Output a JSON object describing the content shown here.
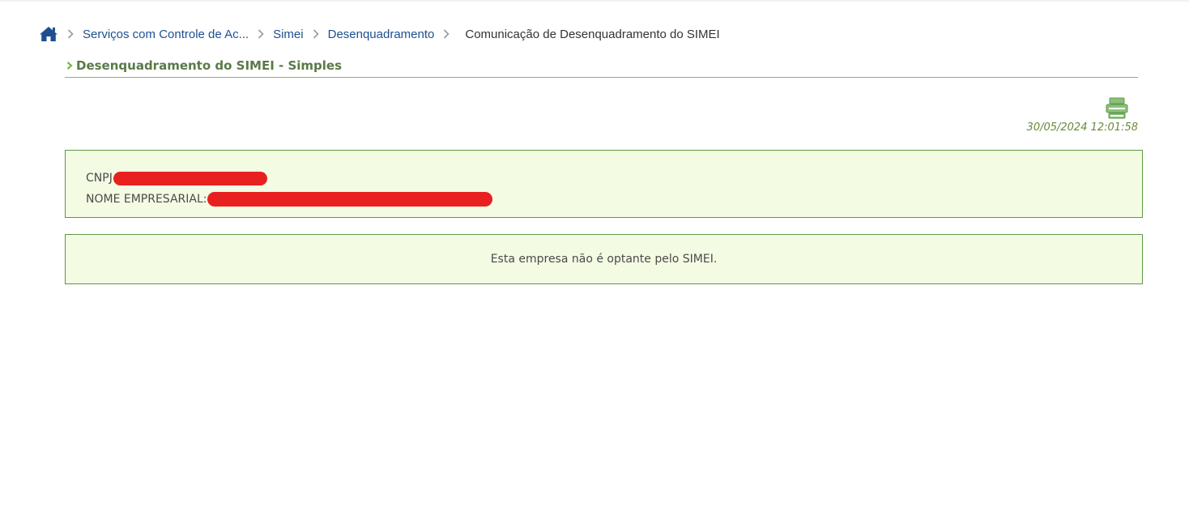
{
  "breadcrumb": {
    "home_icon": "home-icon",
    "items": [
      {
        "label": "Serviços com Controle de Ac..."
      },
      {
        "label": "Simei"
      },
      {
        "label": "Desenquadramento"
      }
    ],
    "current": "Comunicação de Desenquadramento do SIMEI"
  },
  "section": {
    "title": "Desenquadramento do SIMEI - Simples"
  },
  "toolbar": {
    "print_icon": "printer-icon",
    "timestamp": "30/05/2024 12:01:58"
  },
  "company": {
    "cnpj_label": "CNPJ",
    "nome_label": "NOME EMPRESARIAL:"
  },
  "message": {
    "text": "Esta empresa não é optante pelo SIMEI."
  },
  "colors": {
    "link": "#1d4f91",
    "title": "#5a7a48",
    "box_bg": "#f4fbe3",
    "box_border": "#5b9a45",
    "redaction": "#e8201f"
  }
}
